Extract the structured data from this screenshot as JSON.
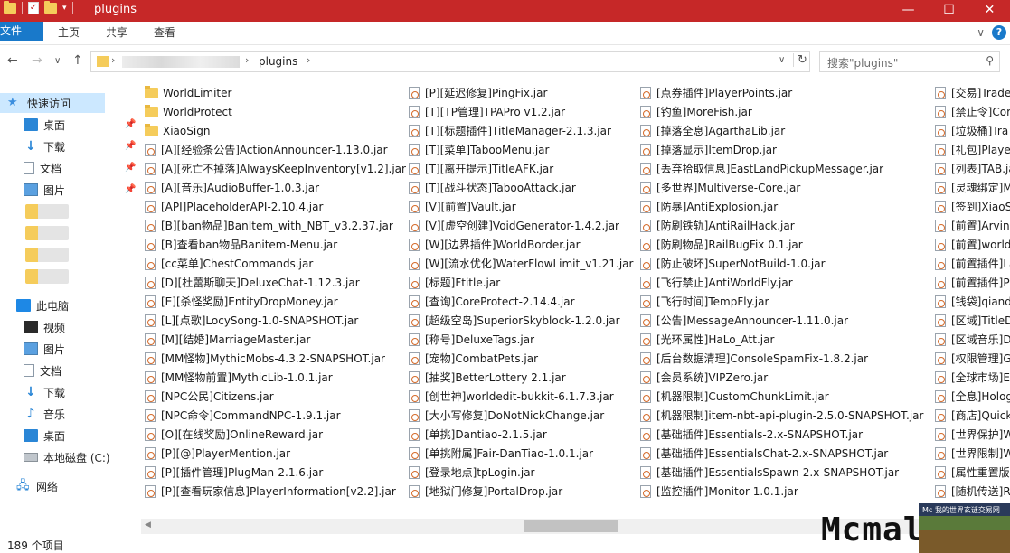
{
  "window": {
    "title": "plugins",
    "controls": [
      "minimize",
      "maximize",
      "close"
    ]
  },
  "ribbon": {
    "tabs": [
      "文件",
      "主页",
      "共享",
      "查看"
    ]
  },
  "address": {
    "crumb": "plugins",
    "search_placeholder": "搜索\"plugins\""
  },
  "nav": {
    "quick_access": "快速访问",
    "quick_items": [
      "桌面",
      "下载",
      "文档",
      "图片"
    ],
    "this_pc": "此电脑",
    "pc_items": [
      "视频",
      "图片",
      "文档",
      "下载",
      "音乐",
      "桌面",
      "本地磁盘 (C:)"
    ],
    "network": "网络"
  },
  "files": {
    "col1": [
      {
        "name": "WorldLimiter",
        "type": "folder"
      },
      {
        "name": "WorldProtect",
        "type": "folder"
      },
      {
        "name": "XiaoSign",
        "type": "folder"
      },
      {
        "name": "[A][经验条公告]ActionAnnouncer-1.13.0.jar",
        "type": "jar"
      },
      {
        "name": "[A][死亡不掉落]AlwaysKeepInventory[v1.2].jar",
        "type": "jar"
      },
      {
        "name": "[A][音乐]AudioBuffer-1.0.3.jar",
        "type": "jar"
      },
      {
        "name": "[API]PlaceholderAPI-2.10.4.jar",
        "type": "jar"
      },
      {
        "name": "[B][ban物品]BanItem_with_NBT_v3.2.37.jar",
        "type": "jar"
      },
      {
        "name": "[B]查看ban物品Banitem-Menu.jar",
        "type": "jar"
      },
      {
        "name": "[cc菜单]ChestCommands.jar",
        "type": "jar"
      },
      {
        "name": "[D][杜蕾斯聊天]DeluxeChat-1.12.3.jar",
        "type": "jar"
      },
      {
        "name": "[E][杀怪奖励]EntityDropMoney.jar",
        "type": "jar"
      },
      {
        "name": "[L][点歌]LocySong-1.0-SNAPSHOT.jar",
        "type": "jar"
      },
      {
        "name": "[M][结婚]MarriageMaster.jar",
        "type": "jar"
      },
      {
        "name": "[MM怪物]MythicMobs-4.3.2-SNAPSHOT.jar",
        "type": "jar"
      },
      {
        "name": "[MM怪物前置]MythicLib-1.0.1.jar",
        "type": "jar"
      },
      {
        "name": "[NPC公民]Citizens.jar",
        "type": "jar"
      },
      {
        "name": "[NPC命令]CommandNPC-1.9.1.jar",
        "type": "jar"
      },
      {
        "name": "[O][在线奖励]OnlineReward.jar",
        "type": "jar"
      },
      {
        "name": "[P][@]PlayerMention.jar",
        "type": "jar"
      },
      {
        "name": "[P][插件管理]PlugMan-2.1.6.jar",
        "type": "jar"
      },
      {
        "name": "[P][查看玩家信息]PlayerInformation[v2.2].jar",
        "type": "jar"
      }
    ],
    "col2": [
      {
        "name": "[P][延迟修复]PingFix.jar",
        "type": "jar"
      },
      {
        "name": "[T][TP管理]TPAPro v1.2.jar",
        "type": "jar"
      },
      {
        "name": "[T][标题插件]TitleManager-2.1.3.jar",
        "type": "jar"
      },
      {
        "name": "[T][菜单]TabooMenu.jar",
        "type": "jar"
      },
      {
        "name": "[T][离开提示]TitleAFK.jar",
        "type": "jar"
      },
      {
        "name": "[T][战斗状态]TabooAttack.jar",
        "type": "jar"
      },
      {
        "name": "[V][前置]Vault.jar",
        "type": "jar"
      },
      {
        "name": "[V][虚空创建]VoidGenerator-1.4.2.jar",
        "type": "jar"
      },
      {
        "name": "[W][边界插件]WorldBorder.jar",
        "type": "jar"
      },
      {
        "name": "[W][流水优化]WaterFlowLimit_v1.21.jar",
        "type": "jar"
      },
      {
        "name": "[标题]Ftitle.jar",
        "type": "jar"
      },
      {
        "name": "[查询]CoreProtect-2.14.4.jar",
        "type": "jar"
      },
      {
        "name": "[超级空岛]SuperiorSkyblock-1.2.0.jar",
        "type": "jar"
      },
      {
        "name": "[称号]DeluxeTags.jar",
        "type": "jar"
      },
      {
        "name": "[宠物]CombatPets.jar",
        "type": "jar"
      },
      {
        "name": "[抽奖]BetterLottery 2.1.jar",
        "type": "jar"
      },
      {
        "name": "[创世神]worldedit-bukkit-6.1.7.3.jar",
        "type": "jar"
      },
      {
        "name": "[大小写修复]DoNotNickChange.jar",
        "type": "jar"
      },
      {
        "name": "[单挑]Dantiao-2.1.5.jar",
        "type": "jar"
      },
      {
        "name": "[单挑附属]Fair-DanTiao-1.0.1.jar",
        "type": "jar"
      },
      {
        "name": "[登录地点]tpLogin.jar",
        "type": "jar"
      },
      {
        "name": "[地狱门修复]PortalDrop.jar",
        "type": "jar"
      }
    ],
    "col3": [
      {
        "name": "[点券插件]PlayerPoints.jar",
        "type": "jar"
      },
      {
        "name": "[钓鱼]MoreFish.jar",
        "type": "jar"
      },
      {
        "name": "[掉落全息]AgarthaLib.jar",
        "type": "jar"
      },
      {
        "name": "[掉落显示]ItemDrop.jar",
        "type": "jar"
      },
      {
        "name": "[丢弃拾取信息]EastLandPickupMessager.jar",
        "type": "jar"
      },
      {
        "name": "[多世界]Multiverse-Core.jar",
        "type": "jar"
      },
      {
        "name": "[防暴]AntiExplosion.jar",
        "type": "jar"
      },
      {
        "name": "[防刷铁轨]AntiRailHack.jar",
        "type": "jar"
      },
      {
        "name": "[防刷物品]RailBugFix 0.1.jar",
        "type": "jar"
      },
      {
        "name": "[防止破坏]SuperNotBuild-1.0.jar",
        "type": "jar"
      },
      {
        "name": "[飞行禁止]AntiWorldFly.jar",
        "type": "jar"
      },
      {
        "name": "[飞行时间]TempFly.jar",
        "type": "jar"
      },
      {
        "name": "[公告]MessageAnnouncer-1.11.0.jar",
        "type": "jar"
      },
      {
        "name": "[光环属性]HaLo_Att.jar",
        "type": "jar"
      },
      {
        "name": "[后台数据清理]ConsoleSpamFix-1.8.2.jar",
        "type": "jar"
      },
      {
        "name": "[会员系统]VIPZero.jar",
        "type": "jar"
      },
      {
        "name": "[机器限制]CustomChunkLimit.jar",
        "type": "jar"
      },
      {
        "name": "[机器限制]item-nbt-api-plugin-2.5.0-SNAPSHOT.jar",
        "type": "jar"
      },
      {
        "name": "[基础插件]Essentials-2.x-SNAPSHOT.jar",
        "type": "jar"
      },
      {
        "name": "[基础插件]EssentialsChat-2.x-SNAPSHOT.jar",
        "type": "jar"
      },
      {
        "name": "[基础插件]EssentialsSpawn-2.x-SNAPSHOT.jar",
        "type": "jar"
      },
      {
        "name": "[监控插件]Monitor 1.0.1.jar",
        "type": "jar"
      }
    ],
    "col4": [
      {
        "name": "[交易]Trade",
        "type": "jar"
      },
      {
        "name": "[禁止令]Cor",
        "type": "jar"
      },
      {
        "name": "[垃圾桶]Tra",
        "type": "jar"
      },
      {
        "name": "[礼包]Player",
        "type": "jar"
      },
      {
        "name": "[列表]TAB.ja",
        "type": "jar"
      },
      {
        "name": "[灵魂绑定]M",
        "type": "jar"
      },
      {
        "name": "[签到]XiaoS",
        "type": "jar"
      },
      {
        "name": "[前置]Arvinl",
        "type": "jar"
      },
      {
        "name": "[前置]world",
        "type": "jar"
      },
      {
        "name": "[前置插件]La",
        "type": "jar"
      },
      {
        "name": "[前置插件]P",
        "type": "jar"
      },
      {
        "name": "[钱袋]qiand",
        "type": "jar"
      },
      {
        "name": "[区域]TitleD",
        "type": "jar"
      },
      {
        "name": "[区域音乐]D",
        "type": "jar"
      },
      {
        "name": "[权限管理]G",
        "type": "jar"
      },
      {
        "name": "[全球市场]E",
        "type": "jar"
      },
      {
        "name": "[全息]Holog",
        "type": "jar"
      },
      {
        "name": "[商店]Quick",
        "type": "jar"
      },
      {
        "name": "[世界保护]W",
        "type": "jar"
      },
      {
        "name": "[世界限制]W",
        "type": "jar"
      },
      {
        "name": "[属性重置版",
        "type": "jar"
      },
      {
        "name": "[随机传送]R",
        "type": "jar"
      }
    ]
  },
  "status": {
    "item_count": "189 个项目"
  },
  "watermark": {
    "text": "Mcmal",
    "badge_text": "Mc 我的世界玄谜交易网"
  }
}
